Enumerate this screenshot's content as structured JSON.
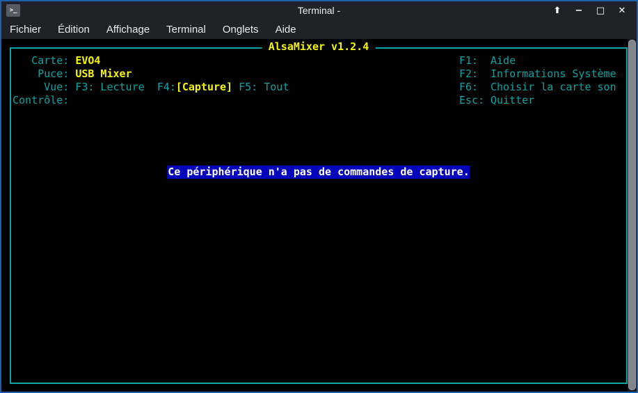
{
  "window": {
    "title": "Terminal -",
    "icon_glyph": ">_",
    "controls": {
      "rollup": "⬆",
      "minimize": "−",
      "maximize": "□",
      "close": "✕"
    }
  },
  "menubar": {
    "items": [
      "Fichier",
      "Édition",
      "Affichage",
      "Terminal",
      "Onglets",
      "Aide"
    ]
  },
  "alsamixer": {
    "title": "AlsaMixer v1.2.4",
    "fields": [
      {
        "label": "   Carte: ",
        "value": "EVO4"
      },
      {
        "label": "    Puce: ",
        "value": "USB Mixer"
      }
    ],
    "view_line": {
      "prefix": "     Vue: F3: Lecture  F4:",
      "active": "[Capture]",
      "suffix": " F5: Tout"
    },
    "control_label": "Contrôle:",
    "shortcuts": [
      {
        "key": "F1:",
        "label": "Aide"
      },
      {
        "key": "F2:",
        "label": "Informations Système"
      },
      {
        "key": "F6:",
        "label": "Choisir la carte son"
      },
      {
        "key": "Esc:",
        "label": "Quitter"
      }
    ],
    "message": "Ce périphérique n'a pas de commandes de capture."
  },
  "colors": {
    "cyan": "#0aa3a3",
    "yellow": "#f5f500",
    "msg-bg": "#0404ba",
    "frame": "#1d61ae",
    "chrome": "#1f2329",
    "chrome-text": "#e9ecef",
    "term-bg": "#000000",
    "scrollbar": "#7e858c"
  }
}
